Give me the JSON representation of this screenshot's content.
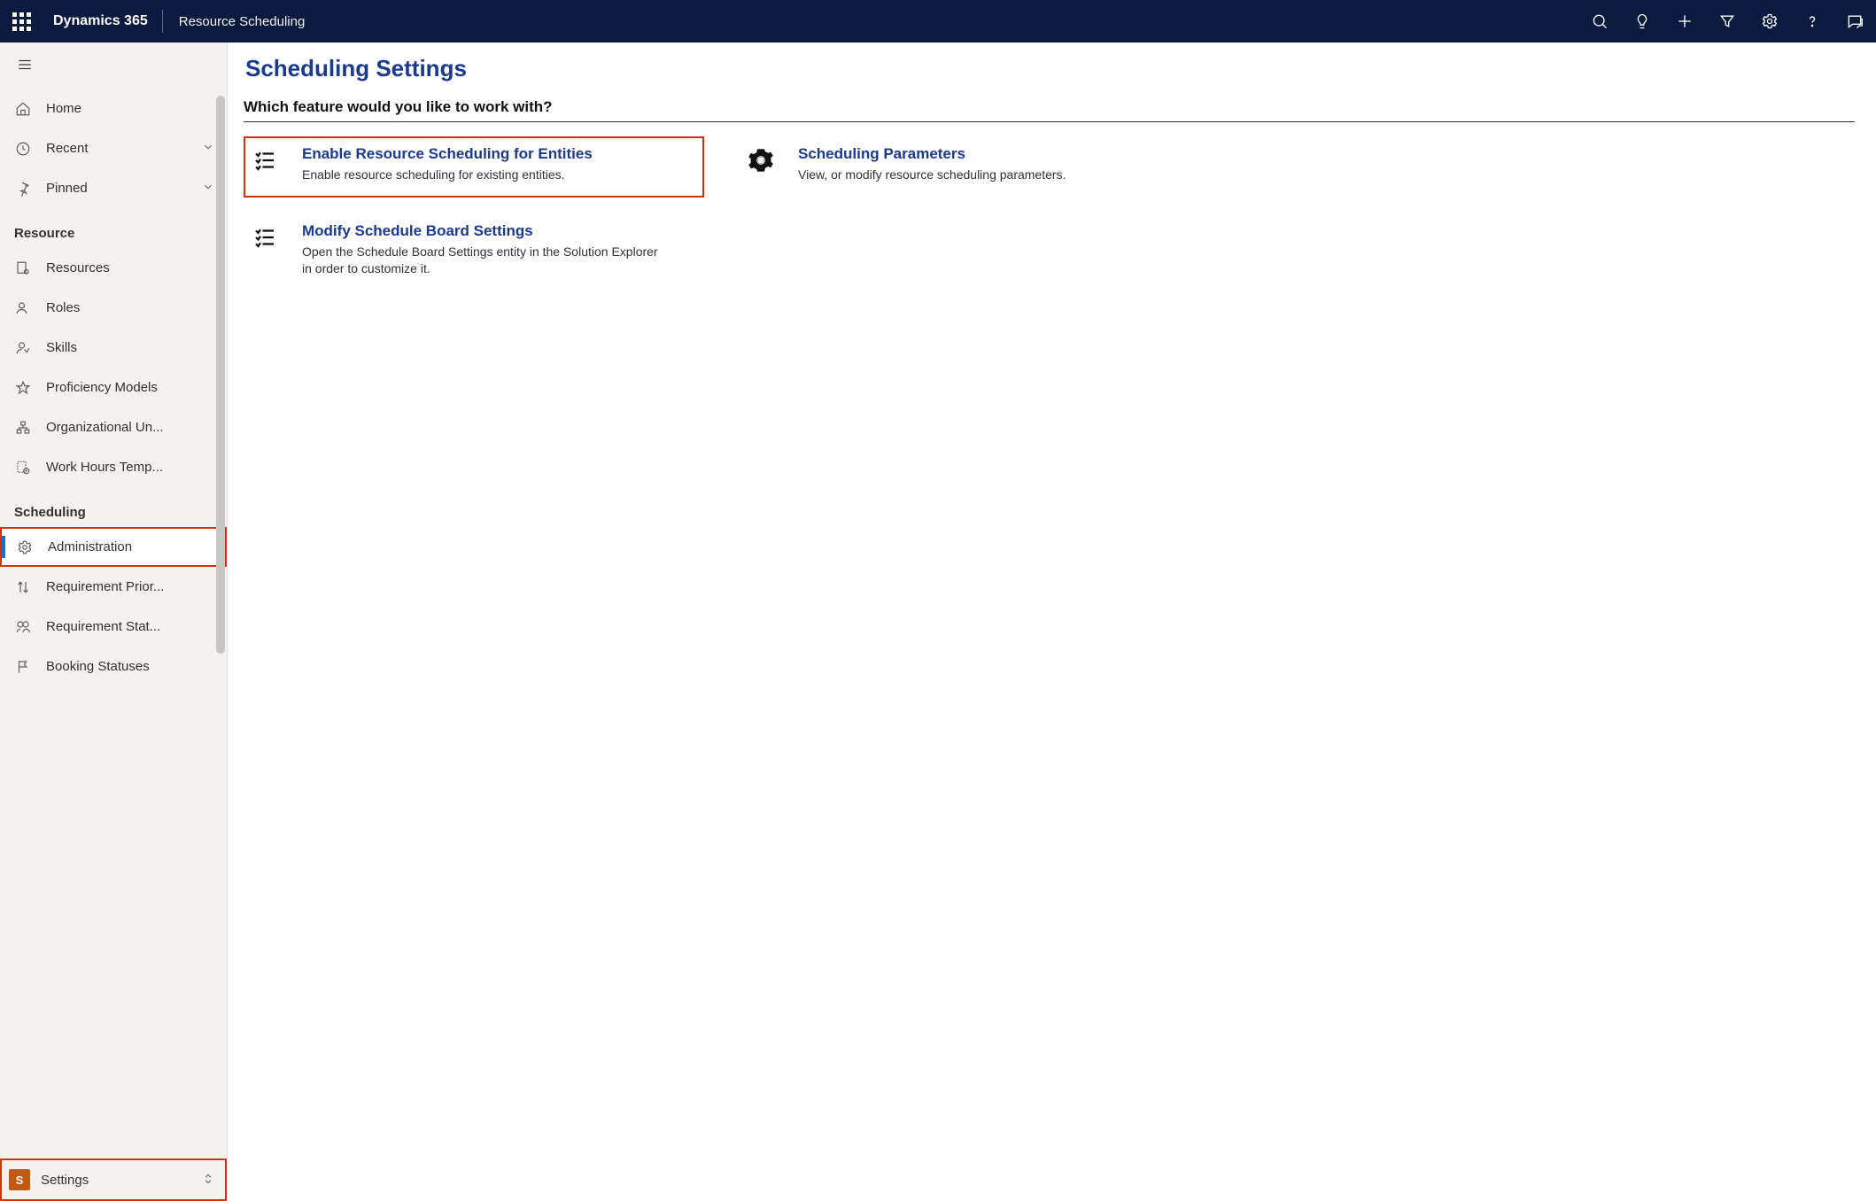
{
  "header": {
    "brand": "Dynamics 365",
    "crumb": "Resource Scheduling"
  },
  "sidebar": {
    "top": {
      "home": "Home",
      "recent": "Recent",
      "pinned": "Pinned"
    },
    "groups": [
      {
        "title": "Resource",
        "items": [
          {
            "label": "Resources",
            "icon": "resource"
          },
          {
            "label": "Roles",
            "icon": "role"
          },
          {
            "label": "Skills",
            "icon": "skill"
          },
          {
            "label": "Proficiency Models",
            "icon": "star"
          },
          {
            "label": "Organizational Un...",
            "icon": "org"
          },
          {
            "label": "Work Hours Temp...",
            "icon": "template"
          }
        ]
      },
      {
        "title": "Scheduling",
        "items": [
          {
            "label": "Administration",
            "icon": "gear",
            "selected": true,
            "highlight": true
          },
          {
            "label": "Requirement Prior...",
            "icon": "priority"
          },
          {
            "label": "Requirement Stat...",
            "icon": "status"
          },
          {
            "label": "Booking Statuses",
            "icon": "flag"
          }
        ]
      }
    ],
    "area": {
      "badge": "S",
      "label": "Settings"
    }
  },
  "content": {
    "title": "Scheduling Settings",
    "question": "Which feature would you like to work with?",
    "col1": [
      {
        "title": "Enable Resource Scheduling for Entities",
        "desc": "Enable resource scheduling for existing entities.",
        "icon": "checklist",
        "highlight": true
      },
      {
        "title": "Modify Schedule Board Settings",
        "desc": "Open the Schedule Board Settings entity in the Solution Explorer in order to customize it.",
        "icon": "checklist"
      }
    ],
    "col2": [
      {
        "title": "Scheduling Parameters",
        "desc": "View, or modify resource scheduling parameters.",
        "icon": "gear"
      }
    ]
  }
}
